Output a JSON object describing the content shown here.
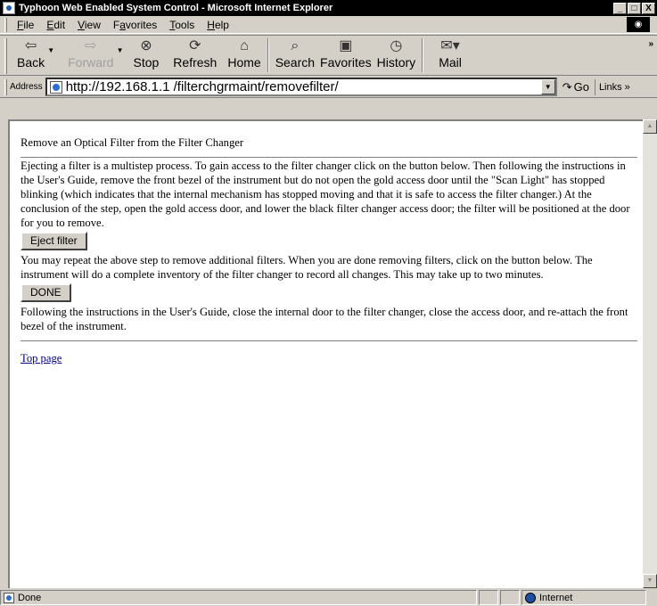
{
  "window": {
    "title": "Typhoon Web Enabled System Control - Microsoft Internet Explorer",
    "controls": [
      "_",
      "□",
      "X"
    ]
  },
  "menu": {
    "items": [
      {
        "u": "F",
        "rest": "ile"
      },
      {
        "u": "E",
        "rest": "dit"
      },
      {
        "u": "V",
        "rest": "iew"
      },
      {
        "pre": "F",
        "u": "a",
        "rest": "vorites"
      },
      {
        "u": "T",
        "rest": "ools"
      },
      {
        "u": "H",
        "rest": "elp"
      }
    ]
  },
  "toolbar": {
    "back": "Back",
    "forward": "Forward",
    "stop": "Stop",
    "refresh": "Refresh",
    "home": "Home",
    "search": "Search",
    "favorites": "Favorites",
    "history": "History",
    "mail": "Mail"
  },
  "address": {
    "label": "Address",
    "url": "http://192.168.1.1 /filterchgrmaint/removefilter/",
    "go": "Go",
    "links": "Links"
  },
  "page": {
    "heading": "Remove an Optical Filter from the Filter Changer",
    "para1": "Ejecting a filter is a multistep process. To gain access to the filter changer click on the button below. Then following the instructions in the User's Guide, remove the front bezel of the instrument but do not open the gold access door until the \"Scan Light\" has stopped blinking (which indicates that the internal mechanism has stopped moving and that it is safe to access the filter changer.) At the conclusion of the step, open the gold access door, and lower the black filter changer access door; the filter will be positioned at the door for you to remove.",
    "eject_button": "Eject filter",
    "para2": "You may repeat the above step to remove additional filters. When you are done removing filters, click on the button below. The instrument will do a complete inventory of the filter changer to record all changes. This may take up to two minutes.",
    "done_button": "DONE",
    "para3": "Following the instructions in the User's Guide, close the internal door to the filter changer, close the access door, and re-attach the front bezel of the instrument.",
    "top_link": "Top page"
  },
  "status": {
    "text": "Done",
    "zone": "Internet"
  }
}
